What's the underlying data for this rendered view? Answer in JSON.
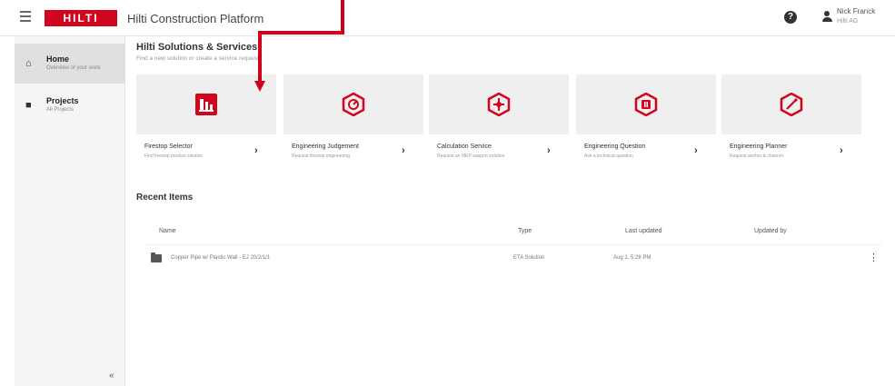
{
  "header": {
    "logo_text": "HILTI",
    "app_title": "Hilti Construction Platform",
    "help_glyph": "?",
    "user_name": "Nick Franck",
    "user_sub": "Hilti AG"
  },
  "sidebar": {
    "items": [
      {
        "label": "Home",
        "sub": "Overview of your work",
        "icon": "home-icon"
      },
      {
        "label": "Projects",
        "sub": "All Projects",
        "icon": "folder-icon"
      }
    ],
    "collapse_glyph": "«"
  },
  "main": {
    "title": "Hilti Solutions & Services",
    "subtitle": "Find a new solution or create a service request"
  },
  "cards": [
    {
      "title": "Firestop Selector",
      "sub": "Find firestop product solution",
      "icon": "firestop-icon"
    },
    {
      "title": "Engineering Judgement",
      "sub": "Request firestop engineering",
      "icon": "engineering-judgement-icon"
    },
    {
      "title": "Calculation Service",
      "sub": "Request an MEP support solution",
      "icon": "calculation-service-icon"
    },
    {
      "title": "Engineering Question",
      "sub": "Ask a technical question",
      "icon": "engineering-question-icon"
    },
    {
      "title": "Engineering Planner",
      "sub": "Request anchor & channel",
      "icon": "engineering-planner-icon"
    }
  ],
  "recent": {
    "title": "Recent Items",
    "columns": [
      "Name",
      "Type",
      "Last updated",
      "Updated by"
    ],
    "rows": [
      {
        "name": "Copper Pipe w/ Plastic Wall - EJ 20/2/1/1",
        "type": "ETA Solution",
        "updated": "Aug 1, 5:28 PM",
        "by": ""
      }
    ],
    "chevron": "›",
    "kebab": "⋮"
  },
  "colors": {
    "brand_red": "#d2051e",
    "annotation_red": "#d0021b"
  }
}
